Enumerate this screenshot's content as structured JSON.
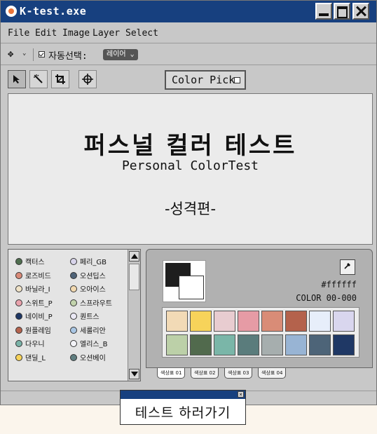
{
  "window": {
    "title": "K-test.exe"
  },
  "menu": [
    "File",
    "Edit",
    "Image",
    "Layer",
    "Select"
  ],
  "options_bar": {
    "auto_select_label": "자동선택:",
    "layer_select_value": "레이어 ⌄"
  },
  "tools": {
    "icons": [
      "arrow-icon",
      "magic-wand-icon",
      "crop-icon",
      "crosshair-icon"
    ],
    "color_pick_label": "Color Pick"
  },
  "canvas": {
    "title": "퍼스널 컬러 테스트",
    "subtitle": "Personal ColorTest",
    "section": "-성격편-"
  },
  "layers": {
    "left": [
      {
        "label": "캑터스",
        "color": "#4f6e4f"
      },
      {
        "label": "로즈비드",
        "color": "#d98a78"
      },
      {
        "label": "바닐라_I",
        "color": "#f0e3c8"
      },
      {
        "label": "스위트_P",
        "color": "#e9a2ac"
      },
      {
        "label": "네이비_P",
        "color": "#1e3765"
      },
      {
        "label": "원플레임",
        "color": "#b5634e"
      },
      {
        "label": "다우니",
        "color": "#7ab3a8"
      },
      {
        "label": "댄딜_L",
        "color": "#f7d35a"
      }
    ],
    "right": [
      {
        "label": "페리_GB",
        "color": "#d8d4ea"
      },
      {
        "label": "오션딥스",
        "color": "#4f6378"
      },
      {
        "label": "오아이스",
        "color": "#f2d9b0"
      },
      {
        "label": "스프라우트",
        "color": "#c2d3ac"
      },
      {
        "label": "퀀트스",
        "color": "#ebe9f5"
      },
      {
        "label": "세룰리안",
        "color": "#a9c6e4"
      },
      {
        "label": "엘리스_B",
        "color": "#f4f4f8"
      },
      {
        "label": "오션베이",
        "color": "#5f7e80"
      }
    ]
  },
  "palette": {
    "foreground": "#1e1e1e",
    "background": "#ffffff",
    "hex_label": "#ffffff",
    "color_code": "COLOR 00-000",
    "swatches": [
      "#f2dab6",
      "#f7d35a",
      "#e8ccd0",
      "#e69ba5",
      "#d98c77",
      "#b4624c",
      "#e7eefa",
      "#d9d6ee",
      "#bcd0a8",
      "#516a4d",
      "#7ab6a8",
      "#5a7c7c",
      "#a6aeae",
      "#98b4d4",
      "#4d6478",
      "#1f3865"
    ],
    "tabs": [
      "색상표 01",
      "색상표 02",
      "색상표 03",
      "색상표 04"
    ]
  },
  "popup": {
    "label": "테스트 하러가기"
  }
}
